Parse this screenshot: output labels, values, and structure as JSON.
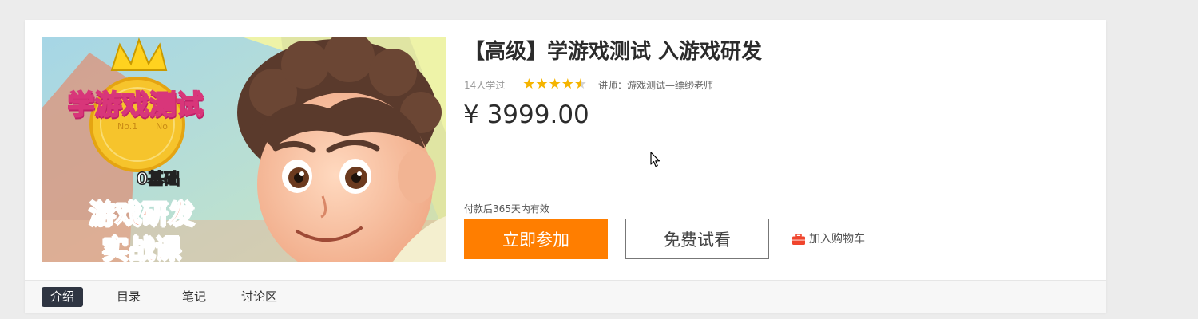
{
  "cover": {
    "title": "学游戏测试",
    "zero_basis": "0基础",
    "line1": "游戏研发",
    "line2": "实战课",
    "medal_text_left": "No.1",
    "medal_text_right": "No"
  },
  "course": {
    "title": "【高级】学游戏测试 入游戏研发",
    "learners": "14人学过",
    "rating": 4.5,
    "teacher_label": "讲师：",
    "teacher_name": "游戏测试—缥缈老师",
    "price": "¥ 3999.00",
    "validity": "付款后365天内有效"
  },
  "actions": {
    "join_label": "立即参加",
    "trial_label": "免费试看",
    "cart_label": "加入购物车",
    "cart_icon": "toolbox-icon"
  },
  "tabs": [
    {
      "label": "介绍",
      "active": true
    },
    {
      "label": "目录",
      "active": false
    },
    {
      "label": "笔记",
      "active": false
    },
    {
      "label": "讨论区",
      "active": false
    }
  ],
  "colors": {
    "accent": "#ff7e00",
    "star": "#f5b400",
    "active_tab_bg": "#2f3542",
    "cart_icon": "#f0452d"
  }
}
